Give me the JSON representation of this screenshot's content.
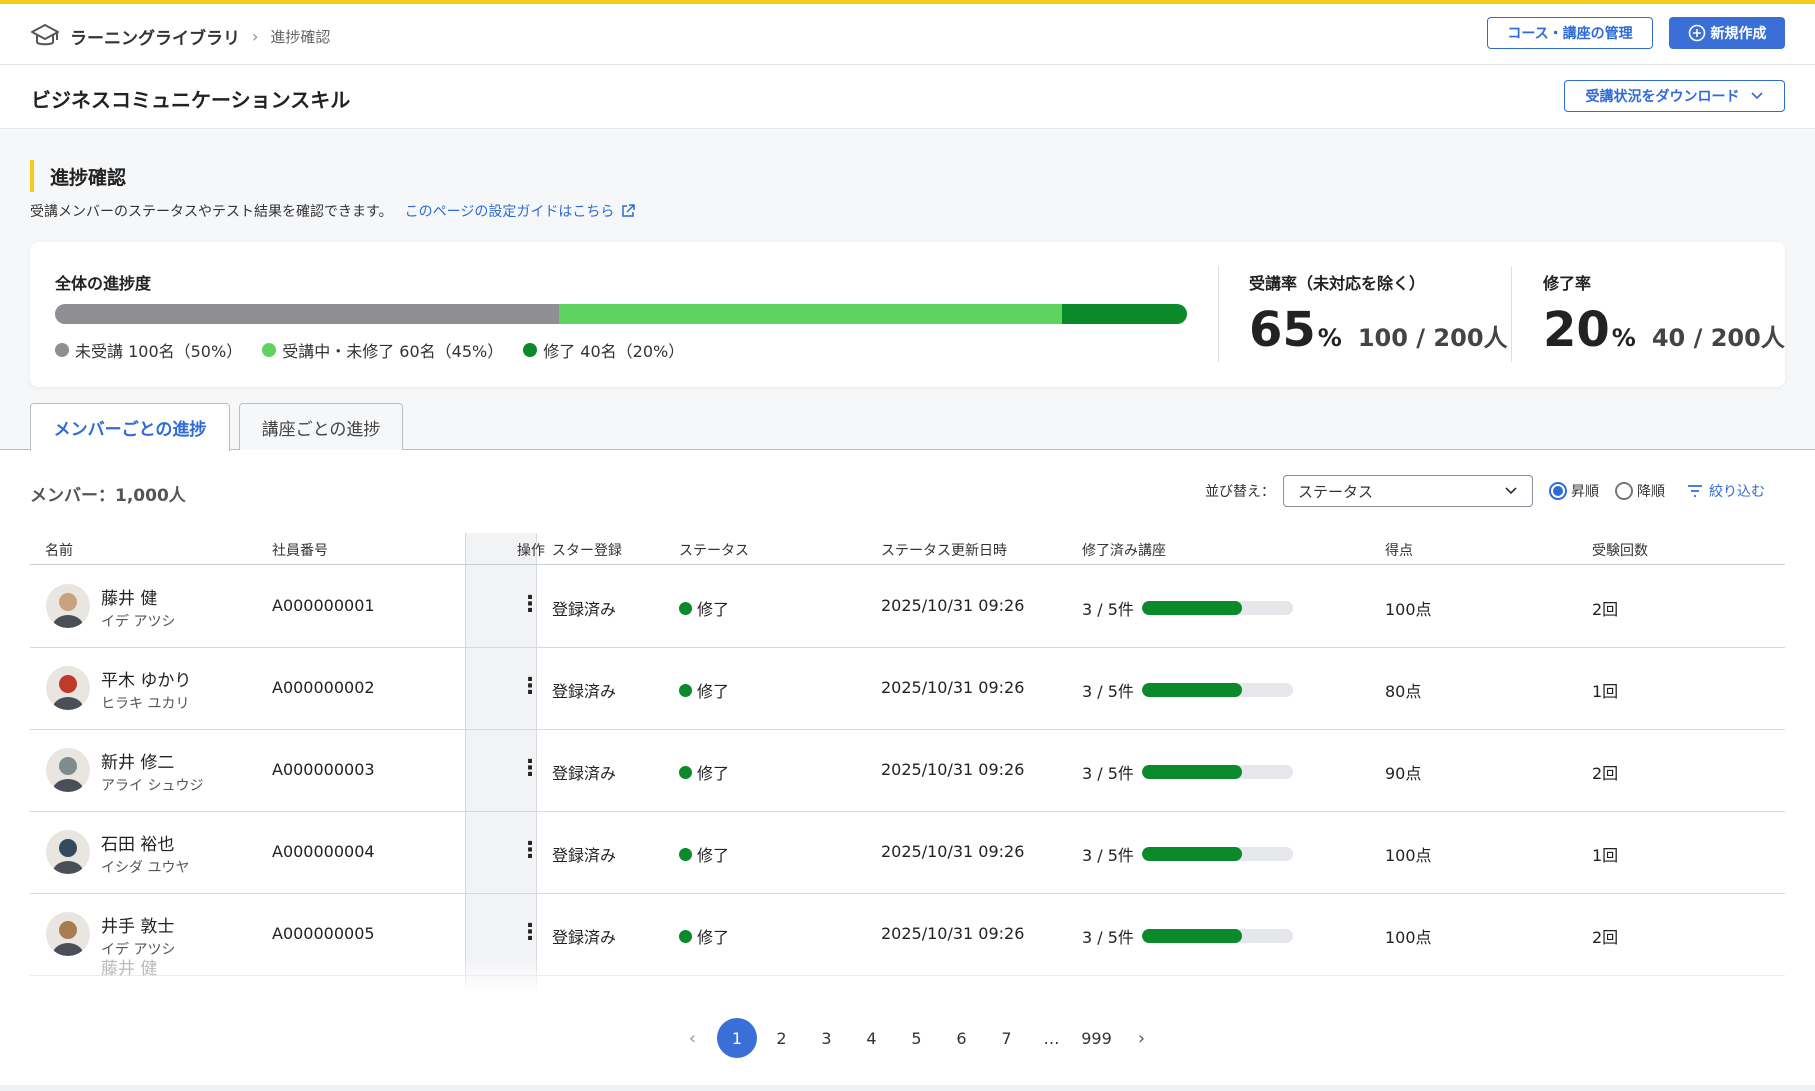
{
  "header": {
    "app_title": "ラーニングライブラリ",
    "breadcrumb_current": "進捗確認",
    "manage_button": "コース・講座の管理",
    "new_button": "新規作成"
  },
  "course": {
    "title": "ビジネスコミュニケーションスキル",
    "download_button": "受講状況をダウンロード"
  },
  "section": {
    "title": "進捗確認",
    "description": "受講メンバーのステータスやテスト結果を確認できます。",
    "guide_link": "このページの設定ガイドはこちら"
  },
  "overall": {
    "label": "全体の進捗度",
    "segments": [
      {
        "name": "未受講",
        "fraction": 0.445,
        "color": "#8e8e93"
      },
      {
        "name": "受講中・未修了",
        "fraction": 0.445,
        "color": "#5fd35f"
      },
      {
        "name": "修了",
        "fraction": 0.11,
        "color": "#0a8a2a"
      }
    ],
    "legend": [
      "未受講 100名（50%）",
      "受講中・未修了 60名（45%）",
      "修了 40名（20%）"
    ],
    "attendance": {
      "label": "受講率（未対応を除く）",
      "value": "65",
      "unit": "%",
      "fraction": "100 / 200人"
    },
    "completion": {
      "label": "修了率",
      "value": "20",
      "unit": "%",
      "fraction": "40 / 200人"
    }
  },
  "tabs": [
    "メンバーごとの進捗",
    "講座ごとの進捗"
  ],
  "list": {
    "count_label": "メンバー：1,000人",
    "sort_label": "並び替え：",
    "sort_value": "ステータス",
    "asc_label": "昇順",
    "desc_label": "降順",
    "filter_label": "絞り込む"
  },
  "table": {
    "columns": [
      "名前",
      "社員番号",
      "操作",
      "スター登録",
      "ステータス",
      "ステータス更新日時",
      "修了済み講座",
      "得点",
      "受験回数"
    ],
    "rows": [
      {
        "name": "藤井 健",
        "kana": "イデ アツシ",
        "id": "A000000001",
        "star": "登録済み",
        "status": "修了",
        "updated": "2025/10/31 09:26",
        "courses": "3 / 5件",
        "progress": 0.66,
        "score": "100点",
        "attempts": "2回",
        "avatar_color": "#c9a27e"
      },
      {
        "name": "平木 ゆかり",
        "kana": "ヒラキ ユカリ",
        "id": "A000000002",
        "star": "登録済み",
        "status": "修了",
        "updated": "2025/10/31 09:26",
        "courses": "3 / 5件",
        "progress": 0.66,
        "score": "80点",
        "attempts": "1回",
        "avatar_color": "#c0392b"
      },
      {
        "name": "新井 修二",
        "kana": "アライ シュウジ",
        "id": "A000000003",
        "star": "登録済み",
        "status": "修了",
        "updated": "2025/10/31 09:26",
        "courses": "3 / 5件",
        "progress": 0.66,
        "score": "90点",
        "attempts": "2回",
        "avatar_color": "#7f8c8d"
      },
      {
        "name": "石田 裕也",
        "kana": "イシダ ユウヤ",
        "id": "A000000004",
        "star": "登録済み",
        "status": "修了",
        "updated": "2025/10/31 09:26",
        "courses": "3 / 5件",
        "progress": 0.66,
        "score": "100点",
        "attempts": "1回",
        "avatar_color": "#34495e"
      },
      {
        "name": "井手 敦士",
        "kana": "イデ アツシ",
        "id": "A000000005",
        "star": "登録済み",
        "status": "修了",
        "updated": "2025/10/31 09:26",
        "courses": "3 / 5件",
        "progress": 0.66,
        "score": "100点",
        "attempts": "2回",
        "avatar_color": "#a67c52"
      }
    ],
    "partial_row_name": "藤井 健"
  },
  "pagination": {
    "pages": [
      "1",
      "2",
      "3",
      "4",
      "5",
      "6",
      "7",
      "…",
      "999"
    ],
    "current": "1"
  },
  "colors": {
    "accent": "#2f6bd6",
    "highlight": "#f5cc1c",
    "complete_green": "#0a8a2a"
  }
}
